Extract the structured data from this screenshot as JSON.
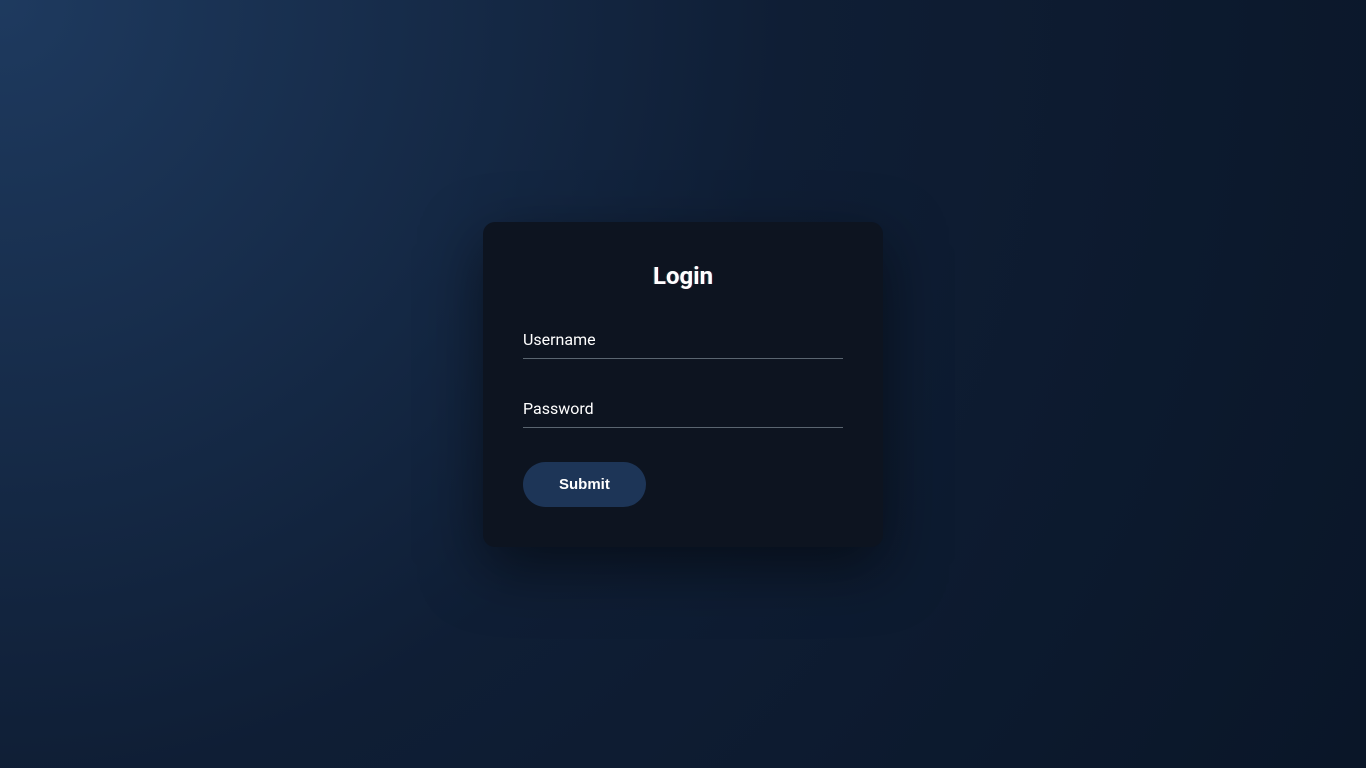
{
  "form": {
    "title": "Login",
    "username": {
      "label": "Username",
      "value": ""
    },
    "password": {
      "label": "Password",
      "value": ""
    },
    "submit_label": "Submit"
  }
}
